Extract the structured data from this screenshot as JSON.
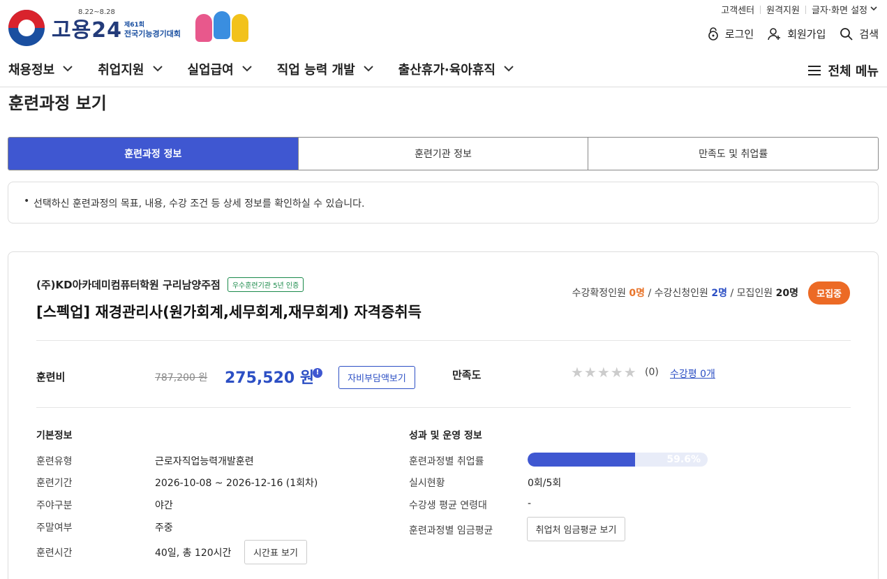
{
  "header": {
    "logo_text": "고용24",
    "event_date": "8.22~8.28",
    "event_sub": "제61회",
    "event_title": "전국기능경기대회",
    "util": [
      "고객센터",
      "원격지원",
      "글자·화면 설정"
    ],
    "login": "로그인",
    "join": "회원가입",
    "search": "검색",
    "nav": [
      "채용정보",
      "취업지원",
      "실업급여",
      "직업 능력 개발",
      "출산휴가·육아휴직"
    ],
    "all_menu": "전체 메뉴"
  },
  "page_title": "훈련과정 보기",
  "tabs": [
    "훈련과정 정보",
    "훈련기관 정보",
    "만족도 및 취업률"
  ],
  "notice": "선택하신 훈련과정의 목표, 내용, 수강 조건 등 상세 정보를 확인하실 수 있습니다.",
  "course": {
    "org": "(주)KD아카데미컴퓨터학원 구리남양주점",
    "cert_badge": "우수훈련기관 5년 인증",
    "title": "[스펙업] 재경관리사(원가회계,세무회계,재무회계) 자격증취득",
    "confirmed_label": "수강확정인원",
    "confirmed": "0명",
    "applied_label": "수강신청인원",
    "applied": "2명",
    "quota_label": "모집인원",
    "quota": "20명",
    "status": "모집중",
    "fee_label": "훈련비",
    "fee_original": "787,200 원",
    "fee_now": "275,520 원",
    "self_pay_button": "자비부담액보기",
    "satisfaction_label": "만족도",
    "stars": "★★★★★",
    "rating_score": 0,
    "satisfaction_count": "(0)",
    "review_link": "수강평 0개"
  },
  "basic": {
    "title": "기본정보",
    "rows": [
      {
        "label": "훈련유형",
        "value": "근로자직업능력개발훈련"
      },
      {
        "label": "훈련기간",
        "value": "2026-10-08 ~ 2026-12-16 (1회차)"
      },
      {
        "label": "주야구분",
        "value": "야간"
      },
      {
        "label": "주말여부",
        "value": "주중"
      },
      {
        "label": "훈련시간",
        "value": "40일, 총 120시간"
      }
    ],
    "timetable_button": "시간표 보기"
  },
  "perf": {
    "title": "성과 및 운영 정보",
    "employment_label": "훈련과정별 취업률",
    "employment_rate": "59.6%",
    "employment_fraction": 0.596,
    "status_label": "실시현황",
    "status_value": "0회/5회",
    "age_label": "수강생 평균 연령대",
    "age_value": "-",
    "wage_label": "훈련과정별 임금평균",
    "wage_button": "취업처 임금평균 보기"
  },
  "colors": {
    "primary": "#3f57d1",
    "orange": "#ec6a25",
    "cert_green": "#1a8a4a"
  }
}
